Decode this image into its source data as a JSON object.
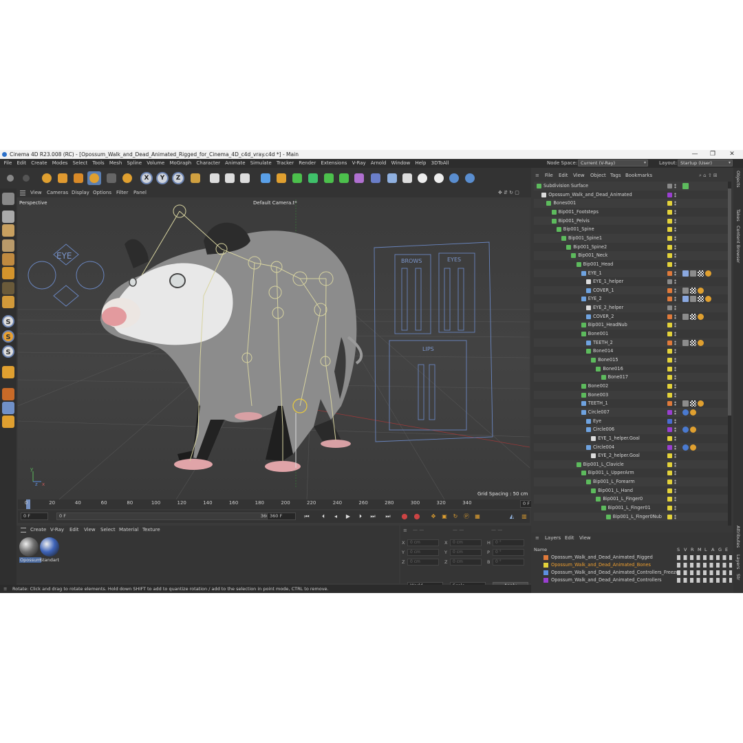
{
  "window": {
    "title": "Cinema 4D R23.008 (RC) - [Opossum_Walk_and_Dead_Animated_Rigged_for_Cinema_4D_c4d_vray.c4d *] - Main",
    "minimize": "—",
    "maximize": "❐",
    "close": "✕"
  },
  "menubar": {
    "items": [
      "File",
      "Edit",
      "Create",
      "Modes",
      "Select",
      "Tools",
      "Mesh",
      "Spline",
      "Volume",
      "MoGraph",
      "Character",
      "Animate",
      "Simulate",
      "Tracker",
      "Render",
      "Extensions",
      "V-Ray",
      "Arnold",
      "Window",
      "Help",
      "3DToAll"
    ],
    "node_space_label": "Node Space:",
    "node_space_value": "Current (V-Ray)",
    "layout_label": "Layout:",
    "layout_value": "Startup (User)"
  },
  "toolbar": {
    "axis_x": "X",
    "axis_y": "Y",
    "axis_z": "Z"
  },
  "left_tools": {
    "s1": "S",
    "s2": "S",
    "s3": "S"
  },
  "viewport": {
    "menu": [
      "View",
      "Cameras",
      "Display",
      "Options",
      "Filter",
      "Panel"
    ],
    "mode": "Perspective",
    "camera": "Default Camera.t*",
    "grid_spacing": "Grid Spacing : 50 cm",
    "controls": {
      "eye_panel": "EYE",
      "brows_label": "BROWS",
      "eyes_label": "EYES",
      "lips_label": "LIPS"
    },
    "axis_y": "y",
    "axis_z": "z",
    "axis_x": "x"
  },
  "timeline": {
    "ticks": [
      "0",
      "20",
      "40",
      "60",
      "80",
      "100",
      "120",
      "140",
      "160",
      "180",
      "200",
      "220",
      "240",
      "260",
      "280",
      "300",
      "320",
      "340"
    ],
    "current_frame": "0 F",
    "start": "0 F",
    "range_start": "0 F",
    "range_end": "360 F",
    "end": "360 F",
    "end_field": "360 F"
  },
  "materials": {
    "menu": [
      "Create",
      "V-Ray",
      "Edit",
      "View",
      "Select",
      "Material",
      "Texture"
    ],
    "items": [
      {
        "name": "Opossum",
        "color": "#6f6f6f"
      },
      {
        "name": "Standart",
        "color": "#3d63b8"
      }
    ]
  },
  "coordinates": {
    "labels": [
      "X",
      "Y",
      "Z",
      "X",
      "Y",
      "Z",
      "H",
      "P",
      "B"
    ],
    "value": "0 cm",
    "angle": "0 °",
    "world": "World",
    "scale": "Scale",
    "apply": "Apply",
    "dashes": "— —"
  },
  "statusbar": {
    "text": "Rotate: Click and drag to rotate elements. Hold down SHIFT to add to quantize rotation / add to the selection in point mode, CTRL to remove."
  },
  "objects_panel": {
    "menu": [
      "File",
      "Edit",
      "View",
      "Object",
      "Tags",
      "Bookmarks"
    ],
    "rows": [
      {
        "name": "Subdivision Surface",
        "indent": 0,
        "icon": "#5dbb5d",
        "layer": "#8a8a8a",
        "tags": [
          "check"
        ]
      },
      {
        "name": "Opossum_Walk_and_Dead_Animated",
        "indent": 1,
        "icon": "#dcdcdc",
        "layer": "#9a3fd1",
        "tags": []
      },
      {
        "name": "Bones001",
        "indent": 2,
        "icon": "#5dbb5d",
        "layer": "#e3d23a",
        "tags": []
      },
      {
        "name": "Bip001_Footsteps",
        "indent": 3,
        "icon": "#5dbb5d",
        "layer": "#e3d23a",
        "tags": []
      },
      {
        "name": "Bip001_Pelvis",
        "indent": 3,
        "icon": "#5dbb5d",
        "layer": "#e3d23a",
        "tags": []
      },
      {
        "name": "Bip001_Spine",
        "indent": 4,
        "icon": "#5dbb5d",
        "layer": "#e3d23a",
        "tags": []
      },
      {
        "name": "Bip001_Spine1",
        "indent": 5,
        "icon": "#5dbb5d",
        "layer": "#e3d23a",
        "tags": []
      },
      {
        "name": "Bip001_Spine2",
        "indent": 6,
        "icon": "#5dbb5d",
        "layer": "#e3d23a",
        "tags": []
      },
      {
        "name": "Bip001_Neck",
        "indent": 7,
        "icon": "#5dbb5d",
        "layer": "#e3d23a",
        "tags": []
      },
      {
        "name": "Bip001_Head",
        "indent": 8,
        "icon": "#5dbb5d",
        "layer": "#e3d23a",
        "tags": []
      },
      {
        "name": "EYE_1",
        "indent": 9,
        "icon": "#6fa3e0",
        "layer": "#e07a3a",
        "tags": [
          "tool",
          "mat",
          "chk",
          "dot"
        ]
      },
      {
        "name": "EYE_1_helper",
        "indent": 10,
        "icon": "#dcdcdc",
        "layer": "#8a8a8a",
        "tags": []
      },
      {
        "name": "COVER_1",
        "indent": 10,
        "icon": "#6fa3e0",
        "layer": "#e07a3a",
        "tags": [
          "mat",
          "chk",
          "dot"
        ]
      },
      {
        "name": "EYE_2",
        "indent": 9,
        "icon": "#6fa3e0",
        "layer": "#e07a3a",
        "tags": [
          "tool",
          "mat",
          "chk",
          "dot"
        ]
      },
      {
        "name": "EYE_2_helper",
        "indent": 10,
        "icon": "#dcdcdc",
        "layer": "#8a8a8a",
        "tags": []
      },
      {
        "name": "COVER_2",
        "indent": 10,
        "icon": "#6fa3e0",
        "layer": "#e07a3a",
        "tags": [
          "mat",
          "chk",
          "dot"
        ]
      },
      {
        "name": "Bip001_HeadNub",
        "indent": 9,
        "icon": "#5dbb5d",
        "layer": "#e3d23a",
        "tags": []
      },
      {
        "name": "Bone001",
        "indent": 9,
        "icon": "#5dbb5d",
        "layer": "#e3d23a",
        "tags": []
      },
      {
        "name": "TEETH_2",
        "indent": 10,
        "icon": "#6fa3e0",
        "layer": "#e07a3a",
        "tags": [
          "mat",
          "chk",
          "dot"
        ]
      },
      {
        "name": "Bone014",
        "indent": 10,
        "icon": "#5dbb5d",
        "layer": "#e3d23a",
        "tags": []
      },
      {
        "name": "Bone015",
        "indent": 11,
        "icon": "#5dbb5d",
        "layer": "#e3d23a",
        "tags": []
      },
      {
        "name": "Bone016",
        "indent": 12,
        "icon": "#5dbb5d",
        "layer": "#e3d23a",
        "tags": []
      },
      {
        "name": "Bone017",
        "indent": 13,
        "icon": "#5dbb5d",
        "layer": "#e3d23a",
        "tags": []
      },
      {
        "name": "Bone002",
        "indent": 9,
        "icon": "#5dbb5d",
        "layer": "#e3d23a",
        "tags": []
      },
      {
        "name": "Bone003",
        "indent": 9,
        "icon": "#5dbb5d",
        "layer": "#e3d23a",
        "tags": []
      },
      {
        "name": "TEETH_1",
        "indent": 9,
        "icon": "#6fa3e0",
        "layer": "#e07a3a",
        "tags": [
          "mat",
          "chk",
          "dot"
        ]
      },
      {
        "name": "Circle007",
        "indent": 9,
        "icon": "#6fa3e0",
        "layer": "#9a3fd1",
        "tags": [
          "sph",
          "dot"
        ]
      },
      {
        "name": "Eye",
        "indent": 10,
        "icon": "#6fa3e0",
        "layer": "#4a6cd1",
        "tags": []
      },
      {
        "name": "Circle006",
        "indent": 10,
        "icon": "#6fa3e0",
        "layer": "#9a3fd1",
        "tags": [
          "sph",
          "dot"
        ]
      },
      {
        "name": "EYE_1_helper.Goal",
        "indent": 11,
        "icon": "#dcdcdc",
        "layer": "#e3d23a",
        "tags": []
      },
      {
        "name": "Circle004",
        "indent": 10,
        "icon": "#6fa3e0",
        "layer": "#9a3fd1",
        "tags": [
          "sph",
          "dot"
        ]
      },
      {
        "name": "EYE_2_helper.Goal",
        "indent": 11,
        "icon": "#dcdcdc",
        "layer": "#e3d23a",
        "tags": []
      },
      {
        "name": "Bip001_L_Clavicle",
        "indent": 8,
        "icon": "#5dbb5d",
        "layer": "#e3d23a",
        "tags": []
      },
      {
        "name": "Bip001_L_UpperArm",
        "indent": 9,
        "icon": "#5dbb5d",
        "layer": "#e3d23a",
        "tags": []
      },
      {
        "name": "Bip001_L_Forearm",
        "indent": 10,
        "icon": "#5dbb5d",
        "layer": "#e3d23a",
        "tags": []
      },
      {
        "name": "Bip001_L_Hand",
        "indent": 11,
        "icon": "#5dbb5d",
        "layer": "#e3d23a",
        "tags": []
      },
      {
        "name": "Bip001_L_Finger0",
        "indent": 12,
        "icon": "#5dbb5d",
        "layer": "#e3d23a",
        "tags": []
      },
      {
        "name": "Bip001_L_Finger01",
        "indent": 13,
        "icon": "#5dbb5d",
        "layer": "#e3d23a",
        "tags": []
      },
      {
        "name": "Bip001_L_Finger0Nub",
        "indent": 14,
        "icon": "#5dbb5d",
        "layer": "#e3d23a",
        "tags": []
      }
    ]
  },
  "layers_panel": {
    "menu": [
      "Layers",
      "Edit",
      "View"
    ],
    "header_name": "Name",
    "header_cols": [
      "S",
      "V",
      "R",
      "M",
      "L",
      "A",
      "G",
      "E"
    ],
    "rows": [
      {
        "name": "Opossum_Walk_and_Dead_Animated_Rigged",
        "color": "#e07a3a",
        "highlight": false
      },
      {
        "name": "Opossum_Walk_and_Dead_Animated_Bones",
        "color": "#e3d23a",
        "highlight": true
      },
      {
        "name": "Opossum_Walk_and_Dead_Animated_Controllers_Freeze",
        "color": "#5d8fe0",
        "highlight": false
      },
      {
        "name": "Opossum_Walk_and_Dead_Animated_Controllers",
        "color": "#9a3fd1",
        "highlight": false
      }
    ]
  },
  "side_tabs": [
    "Objects",
    "Takes",
    "Content Browser",
    "Attributes",
    "Layers",
    "Str"
  ],
  "colors": {
    "accent": "#5b7fb3",
    "bg": "#3a3a3a",
    "panel": "#383838",
    "highlight_text": "#f0a030"
  }
}
